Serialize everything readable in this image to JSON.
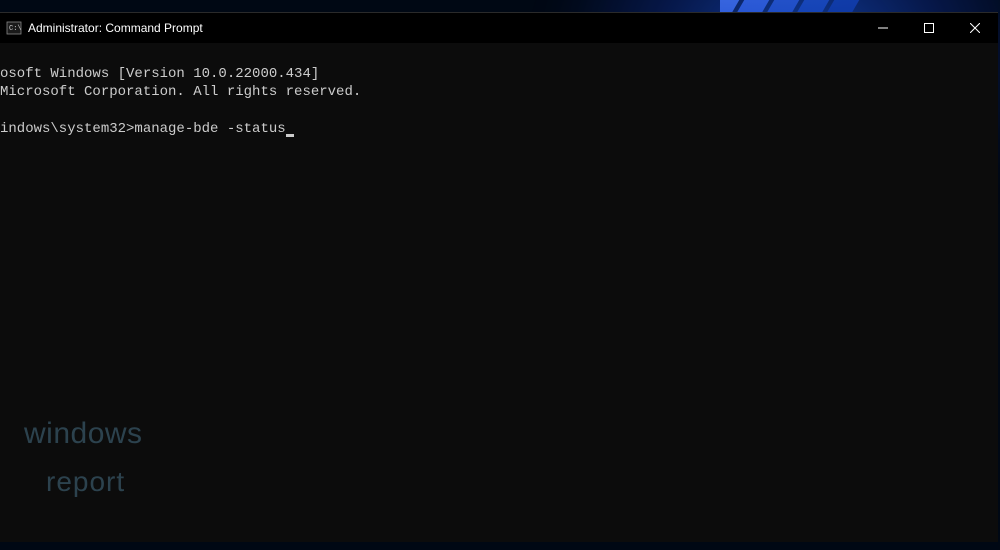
{
  "titlebar": {
    "title": "Administrator: Command Prompt"
  },
  "terminal": {
    "line1": "osoft Windows [Version 10.0.22000.434]",
    "line2": "Microsoft Corporation. All rights reserved.",
    "blank": "",
    "prompt": "indows\\system32>",
    "command": "manage-bde -status"
  },
  "watermark": {
    "line1": "windows",
    "line2": "report"
  },
  "icons": {
    "minimize": "minimize-icon",
    "maximize": "maximize-icon",
    "close": "close-icon",
    "app": "cmd-icon"
  }
}
